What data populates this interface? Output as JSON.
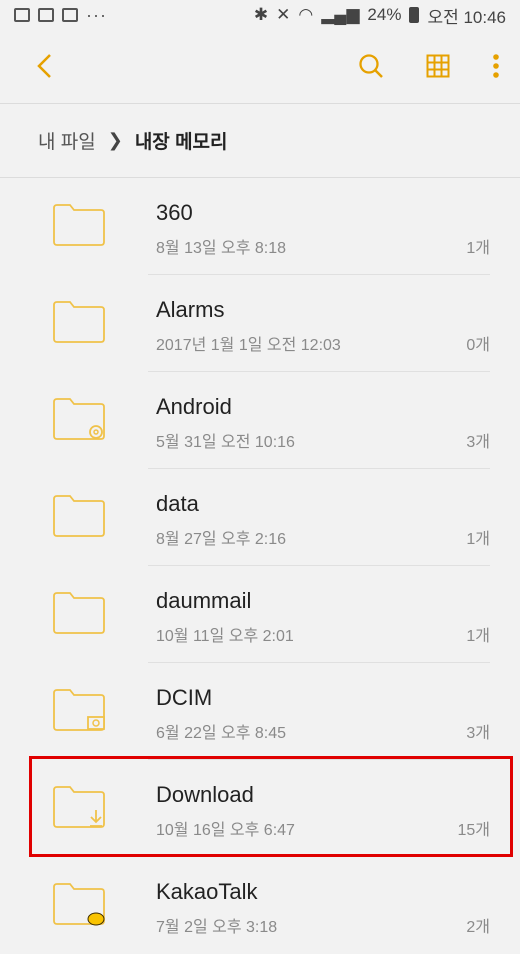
{
  "status_bar": {
    "battery": "24%",
    "time": "오전 10:46",
    "icons_left": [
      "gallery-icon",
      "qr-icon",
      "mail-icon",
      "more-dots-icon"
    ],
    "icons_right": [
      "bluetooth-icon",
      "mute-icon",
      "hd-voice-icon",
      "wifi-icon",
      "signal-icon",
      "battery-icon"
    ]
  },
  "toolbar": {
    "back_icon": "chevron-left-icon",
    "search_icon": "search-icon",
    "grid_icon": "grid-view-icon",
    "more_icon": "more-vert-icon",
    "accent": "#e6a100"
  },
  "breadcrumb": {
    "root": "내 파일",
    "separator": "❯",
    "current": "내장 메모리"
  },
  "folders": [
    {
      "name": "360",
      "date": "8월 13일 오후 8:18",
      "count": "1개",
      "badge": ""
    },
    {
      "name": "Alarms",
      "date": "2017년 1월 1일 오전 12:03",
      "count": "0개",
      "badge": ""
    },
    {
      "name": "Android",
      "date": "5월 31일 오전 10:16",
      "count": "3개",
      "badge": "settings"
    },
    {
      "name": "data",
      "date": "8월 27일 오후 2:16",
      "count": "1개",
      "badge": ""
    },
    {
      "name": "daummail",
      "date": "10월 11일 오후 2:01",
      "count": "1개",
      "badge": ""
    },
    {
      "name": "DCIM",
      "date": "6월 22일 오후 8:45",
      "count": "3개",
      "badge": "camera"
    },
    {
      "name": "Download",
      "date": "10월 16일 오후 6:47",
      "count": "15개",
      "badge": "download"
    },
    {
      "name": "KakaoTalk",
      "date": "7월 2일 오후 3:18",
      "count": "2개",
      "badge": "talk"
    }
  ],
  "colors": {
    "folder_stroke": "#f0c24a",
    "highlight": "#e00000",
    "background": "#f2f2f2"
  }
}
